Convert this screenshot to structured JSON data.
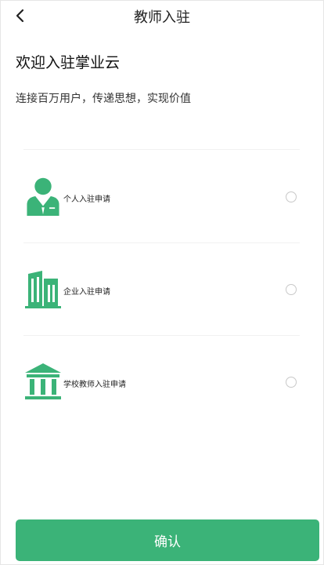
{
  "header": {
    "title": "教师入驻",
    "back_icon": "chevron-left-icon"
  },
  "intro": {
    "title": "欢迎入驻掌业云",
    "subtitle": "连接百万用户，传递思想，实现价值"
  },
  "options": [
    {
      "label": "个人入驻申请",
      "icon": "person-icon",
      "selected": false
    },
    {
      "label": "企业入驻申请",
      "icon": "building-icon",
      "selected": false
    },
    {
      "label": "学校教师入驻申请",
      "icon": "school-icon",
      "selected": false
    }
  ],
  "footer": {
    "confirm_label": "确认"
  },
  "colors": {
    "accent": "#3bb378",
    "radio_border": "#c8c8c8"
  }
}
